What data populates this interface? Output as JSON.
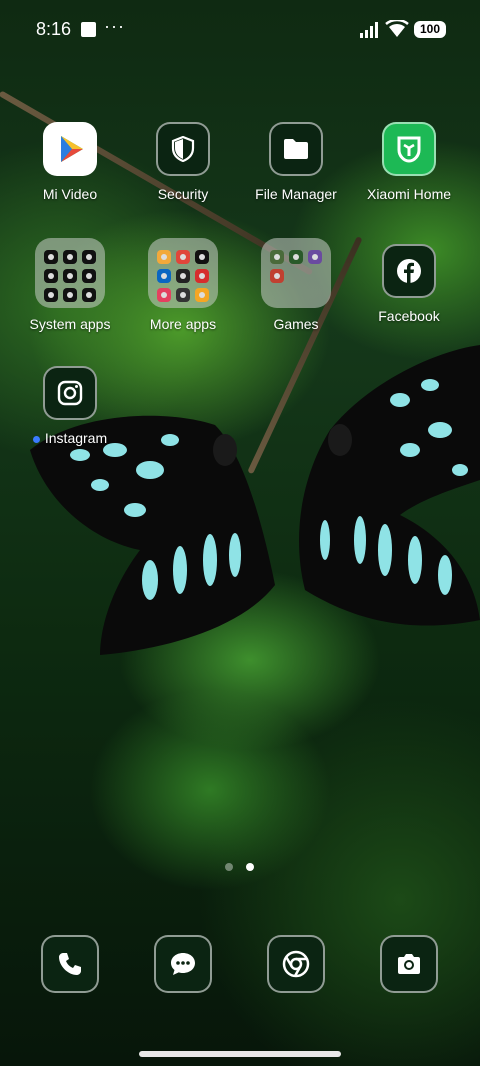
{
  "status_bar": {
    "time": "8:16",
    "overflow_indicator": "···",
    "battery_level": "100"
  },
  "home_screen": {
    "row1": [
      {
        "label": "Mi Video",
        "icon": "mi-video-play-icon"
      },
      {
        "label": "Security",
        "icon": "shield-icon"
      },
      {
        "label": "File Manager",
        "icon": "folder-icon"
      },
      {
        "label": "Xiaomi Home",
        "icon": "xiaomi-home-icon"
      }
    ],
    "row2": [
      {
        "label": "System apps",
        "type": "folder"
      },
      {
        "label": "More apps",
        "type": "folder"
      },
      {
        "label": "Games",
        "type": "folder"
      },
      {
        "label": "Facebook",
        "icon": "facebook-icon"
      }
    ],
    "row3": [
      {
        "label": "Instagram",
        "icon": "instagram-icon",
        "new_indicator": true
      }
    ]
  },
  "page_indicator": {
    "total": 2,
    "current": 2
  },
  "dock": [
    {
      "icon": "phone-icon"
    },
    {
      "icon": "messages-icon"
    },
    {
      "icon": "chrome-icon"
    },
    {
      "icon": "camera-icon"
    }
  ],
  "colors": {
    "accent_blue": "#3b7bff",
    "icon_bg": "#0b2412",
    "mi_home_green": "#1db955"
  }
}
